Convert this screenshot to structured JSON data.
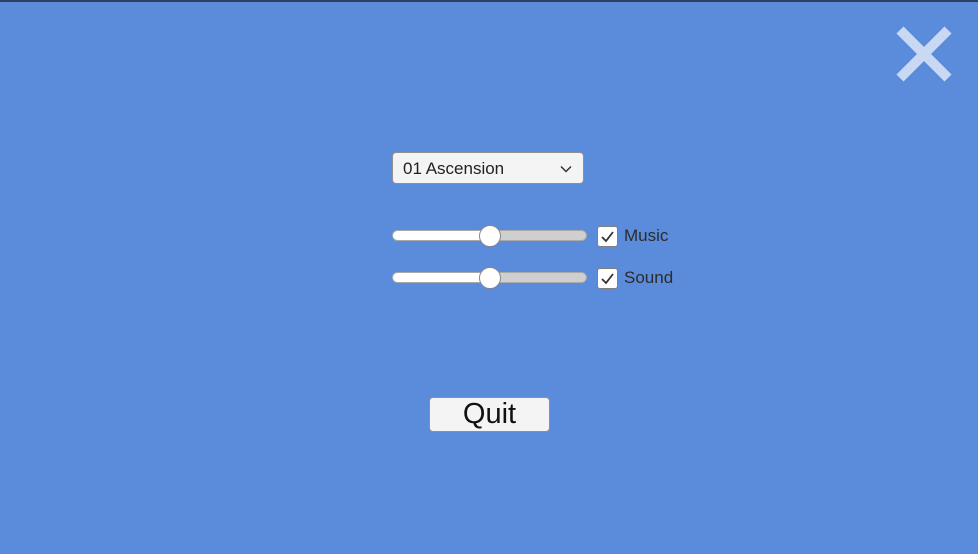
{
  "colors": {
    "background": "#5b8cdb",
    "close_icon": "#c9d8f3",
    "control_surface": "#f4f4f4"
  },
  "close": {
    "icon": "close-icon"
  },
  "track_select": {
    "selected": "01 Ascension",
    "icon": "chevron-down-icon"
  },
  "music": {
    "label": "Music",
    "volume": 0.5,
    "enabled": true
  },
  "sound": {
    "label": "Sound",
    "volume": 0.5,
    "enabled": true
  },
  "quit": {
    "label": "Quit"
  }
}
